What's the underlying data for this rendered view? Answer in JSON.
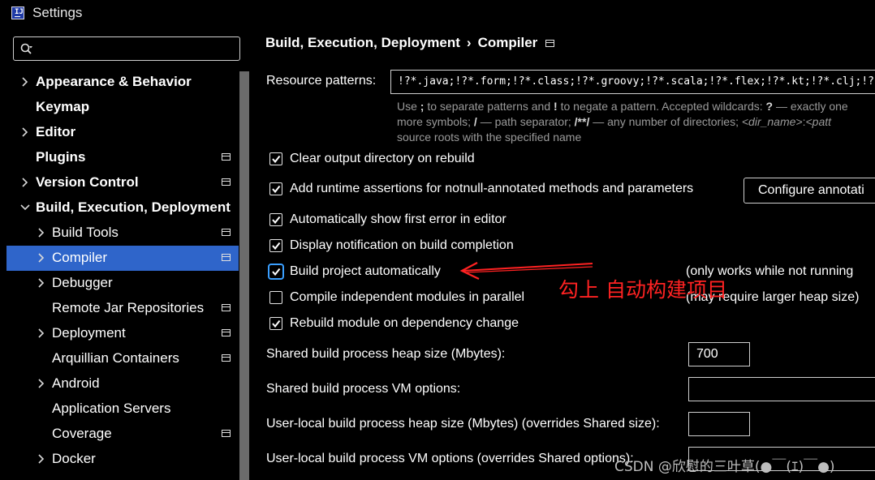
{
  "window": {
    "title": "Settings"
  },
  "search": {
    "placeholder": ""
  },
  "tree": [
    {
      "label": "Appearance & Behavior",
      "bold": true,
      "arrow": "right",
      "indent": 0,
      "proj": false,
      "selected": false
    },
    {
      "label": "Keymap",
      "bold": true,
      "arrow": "none",
      "indent": 0,
      "proj": false,
      "selected": false
    },
    {
      "label": "Editor",
      "bold": true,
      "arrow": "right",
      "indent": 0,
      "proj": false,
      "selected": false
    },
    {
      "label": "Plugins",
      "bold": true,
      "arrow": "none",
      "indent": 0,
      "proj": true,
      "selected": false
    },
    {
      "label": "Version Control",
      "bold": true,
      "arrow": "right",
      "indent": 0,
      "proj": true,
      "selected": false
    },
    {
      "label": "Build, Execution, Deployment",
      "bold": true,
      "arrow": "down",
      "indent": 0,
      "proj": false,
      "selected": false
    },
    {
      "label": "Build Tools",
      "bold": false,
      "arrow": "right",
      "indent": 1,
      "proj": true,
      "selected": false
    },
    {
      "label": "Compiler",
      "bold": false,
      "arrow": "right",
      "indent": 1,
      "proj": true,
      "selected": true
    },
    {
      "label": "Debugger",
      "bold": false,
      "arrow": "right",
      "indent": 1,
      "proj": false,
      "selected": false
    },
    {
      "label": "Remote Jar Repositories",
      "bold": false,
      "arrow": "none",
      "indent": 1,
      "proj": true,
      "selected": false
    },
    {
      "label": "Deployment",
      "bold": false,
      "arrow": "right",
      "indent": 1,
      "proj": true,
      "selected": false
    },
    {
      "label": "Arquillian Containers",
      "bold": false,
      "arrow": "none",
      "indent": 1,
      "proj": true,
      "selected": false
    },
    {
      "label": "Android",
      "bold": false,
      "arrow": "right",
      "indent": 1,
      "proj": false,
      "selected": false
    },
    {
      "label": "Application Servers",
      "bold": false,
      "arrow": "none",
      "indent": 1,
      "proj": false,
      "selected": false
    },
    {
      "label": "Coverage",
      "bold": false,
      "arrow": "none",
      "indent": 1,
      "proj": true,
      "selected": false
    },
    {
      "label": "Docker",
      "bold": false,
      "arrow": "right",
      "indent": 1,
      "proj": false,
      "selected": false
    }
  ],
  "breadcrumb": {
    "part1": "Build, Execution, Deployment",
    "separator": "›",
    "part2": "Compiler"
  },
  "resource": {
    "label": "Resource patterns:",
    "value": "!?*.java;!?*.form;!?*.class;!?*.groovy;!?*.scala;!?*.flex;!?*.kt;!?*.clj;!?*.aj",
    "hint": {
      "t1": "Use ",
      "b1": ";",
      "t2": " to separate patterns and ",
      "b2": "!",
      "t3": " to negate a pattern. Accepted wildcards: ",
      "b3": "?",
      "t4": " — exactly one",
      "t5": "more symbols; ",
      "b4": "/",
      "t6": " — path separator; ",
      "b5": "/**/",
      "t7": " — any number of directories; ",
      "i1": "<dir_name>",
      "t8": ":",
      "i2": "<patt",
      "line3": "source roots with the specified name"
    }
  },
  "options": {
    "clear_output": {
      "label": "Clear output directory on rebuild",
      "checked": true
    },
    "runtime_assert": {
      "label": "Add runtime assertions for notnull-annotated methods and parameters",
      "checked": true
    },
    "show_first_error": {
      "label": "Automatically show first error in editor",
      "checked": true
    },
    "notify_build": {
      "label": "Display notification on build completion",
      "checked": true
    },
    "build_auto": {
      "label": "Build project automatically",
      "checked": true,
      "note": "(only works while not running"
    },
    "compile_parallel": {
      "label": "Compile independent modules in parallel",
      "checked": false,
      "note": "(may require larger heap size)"
    },
    "rebuild_dep": {
      "label": "Rebuild module on dependency change",
      "checked": true
    }
  },
  "configure_button": "Configure annotati",
  "heap": {
    "label": "Shared build process heap size (Mbytes):",
    "value": "700"
  },
  "vm_options": {
    "label": "Shared build process VM options:",
    "value": ""
  },
  "user_heap": {
    "label": "User-local build process heap size (Mbytes) (overrides Shared size):",
    "value": ""
  },
  "user_vm": {
    "label": "User-local build process VM options (overrides Shared options):",
    "value": ""
  },
  "annotation": {
    "text": "勾上 自动构建项目",
    "color": "#ff2222"
  },
  "watermark": "CSDN @欣慰的三叶草(●￣(ｴ)￣●)",
  "colors": {
    "selection": "#2f65ca",
    "focus": "#3a9fff",
    "annotation": "#ff2222"
  }
}
